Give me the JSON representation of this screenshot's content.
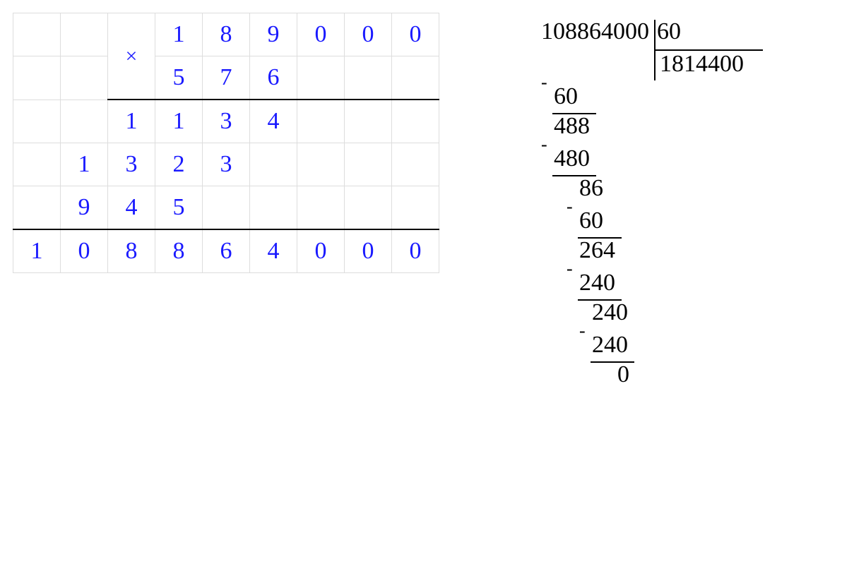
{
  "multiplication": {
    "operator": "×",
    "row0": [
      "",
      "",
      "",
      "1",
      "8",
      "9",
      "0",
      "0",
      "0"
    ],
    "row1": [
      "",
      "",
      "",
      "5",
      "7",
      "6",
      "",
      "",
      ""
    ],
    "row2": [
      "",
      "",
      "1",
      "1",
      "3",
      "4",
      "",
      "",
      ""
    ],
    "row3": [
      "",
      "1",
      "3",
      "2",
      "3",
      "",
      "",
      "",
      ""
    ],
    "row4": [
      "",
      "9",
      "4",
      "5",
      "",
      "",
      "",
      "",
      ""
    ],
    "row5": [
      "1",
      "0",
      "8",
      "8",
      "6",
      "4",
      "0",
      "0",
      "0"
    ]
  },
  "division": {
    "dividend": "108864000",
    "divisor": "60",
    "quotient": "1814400",
    "steps": [
      {
        "minus": true,
        "value": "60",
        "indent": 1,
        "rule_cols": 3
      },
      {
        "minus": false,
        "value": "488",
        "indent": 1
      },
      {
        "minus": true,
        "value": "480",
        "indent": 1,
        "rule_cols": 3
      },
      {
        "minus": false,
        "value": "86",
        "indent": 3
      },
      {
        "minus": true,
        "value": "60",
        "indent": 3,
        "rule_cols": 3
      },
      {
        "minus": false,
        "value": "264",
        "indent": 3
      },
      {
        "minus": true,
        "value": "240",
        "indent": 3,
        "rule_cols": 3
      },
      {
        "minus": false,
        "value": "240",
        "indent": 4
      },
      {
        "minus": true,
        "value": "240",
        "indent": 4,
        "rule_cols": 3
      },
      {
        "minus": false,
        "value": "0",
        "indent": 6
      }
    ]
  }
}
